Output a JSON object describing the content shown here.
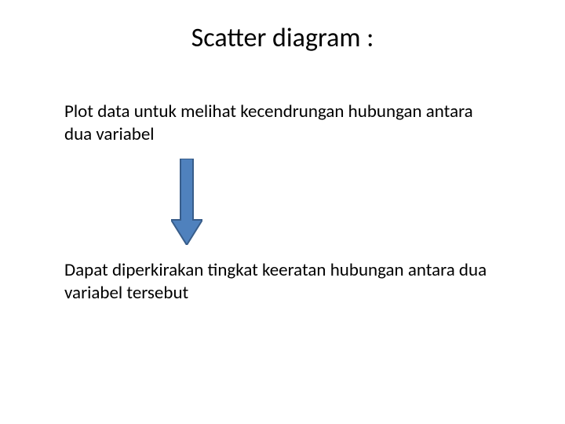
{
  "title": "Scatter diagram :",
  "paragraph1": "Plot data untuk melihat kecendrungan hubungan antara dua variabel",
  "paragraph2": "Dapat diperkirakan tingkat keeratan hubungan antara dua variabel tersebut",
  "arrow": {
    "fill": "#4f81bd",
    "stroke": "#385d8a"
  }
}
